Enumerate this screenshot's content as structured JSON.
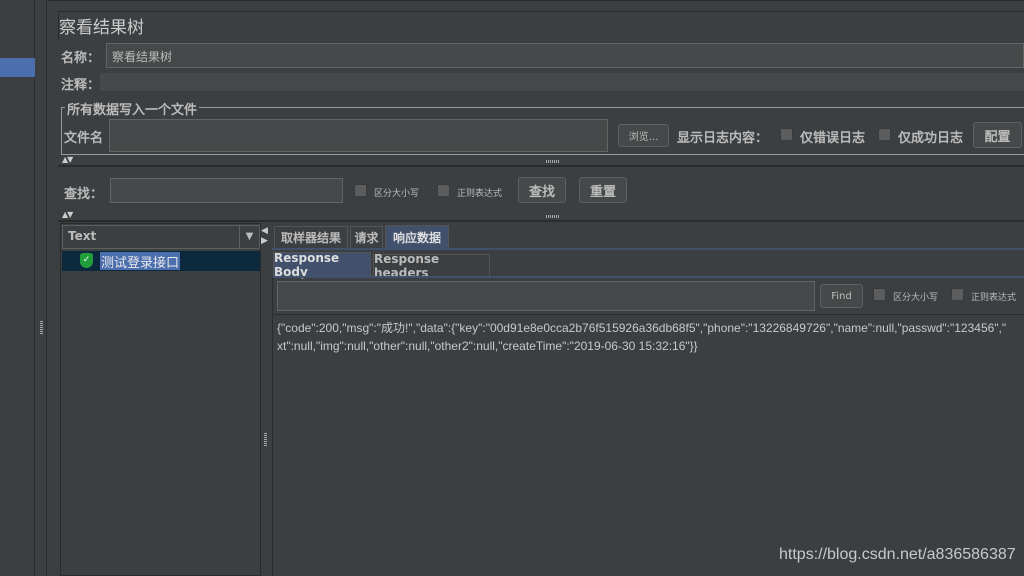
{
  "title": "察看结果树",
  "name_label": "名称：",
  "name_value": "察看结果树",
  "comment_label": "注释：",
  "comment_value": "",
  "file_group": {
    "legend": "所有数据写入一个文件",
    "filename_label": "文件名",
    "filename_value": "",
    "browse": "浏览...",
    "log_label": "显示日志内容：",
    "errors_only": "仅错误日志",
    "success_only": "仅成功日志",
    "configure": "配置"
  },
  "search": {
    "label": "查找：",
    "value": "",
    "case_sensitive": "区分大小写",
    "regex": "正则表达式",
    "find": "查找",
    "reset": "重置"
  },
  "tree": {
    "renderer": "Text",
    "items": [
      {
        "label": "测试登录接口",
        "status": "success"
      }
    ]
  },
  "tabs": [
    {
      "label": "取样器结果"
    },
    {
      "label": "请求"
    },
    {
      "label": "响应数据",
      "selected": true
    }
  ],
  "subtabs": [
    {
      "label": "Response Body",
      "selected": true
    },
    {
      "label": "Response headers"
    }
  ],
  "response_search": {
    "value": "",
    "find": "Find",
    "case_sensitive": "区分大小写",
    "regex": "正则表达式"
  },
  "response_body": [
    "{\"code\":200,\"msg\":\"成功!\",\"data\":{\"key\":\"00d91e8e0cca2b76f515926a36db68f5\",\"phone\":\"13226849726\",\"name\":null,\"passwd\":\"123456\",\"",
    "xt\":null,\"img\":null,\"other\":null,\"other2\":null,\"createTime\":\"2019-06-30 15:32:16\"}}"
  ],
  "watermark": "https://blog.csdn.net/a836586387",
  "colors": {
    "background": "#3c3f41",
    "selection": "#4b6eaf",
    "tab_selected": "#41506b"
  }
}
